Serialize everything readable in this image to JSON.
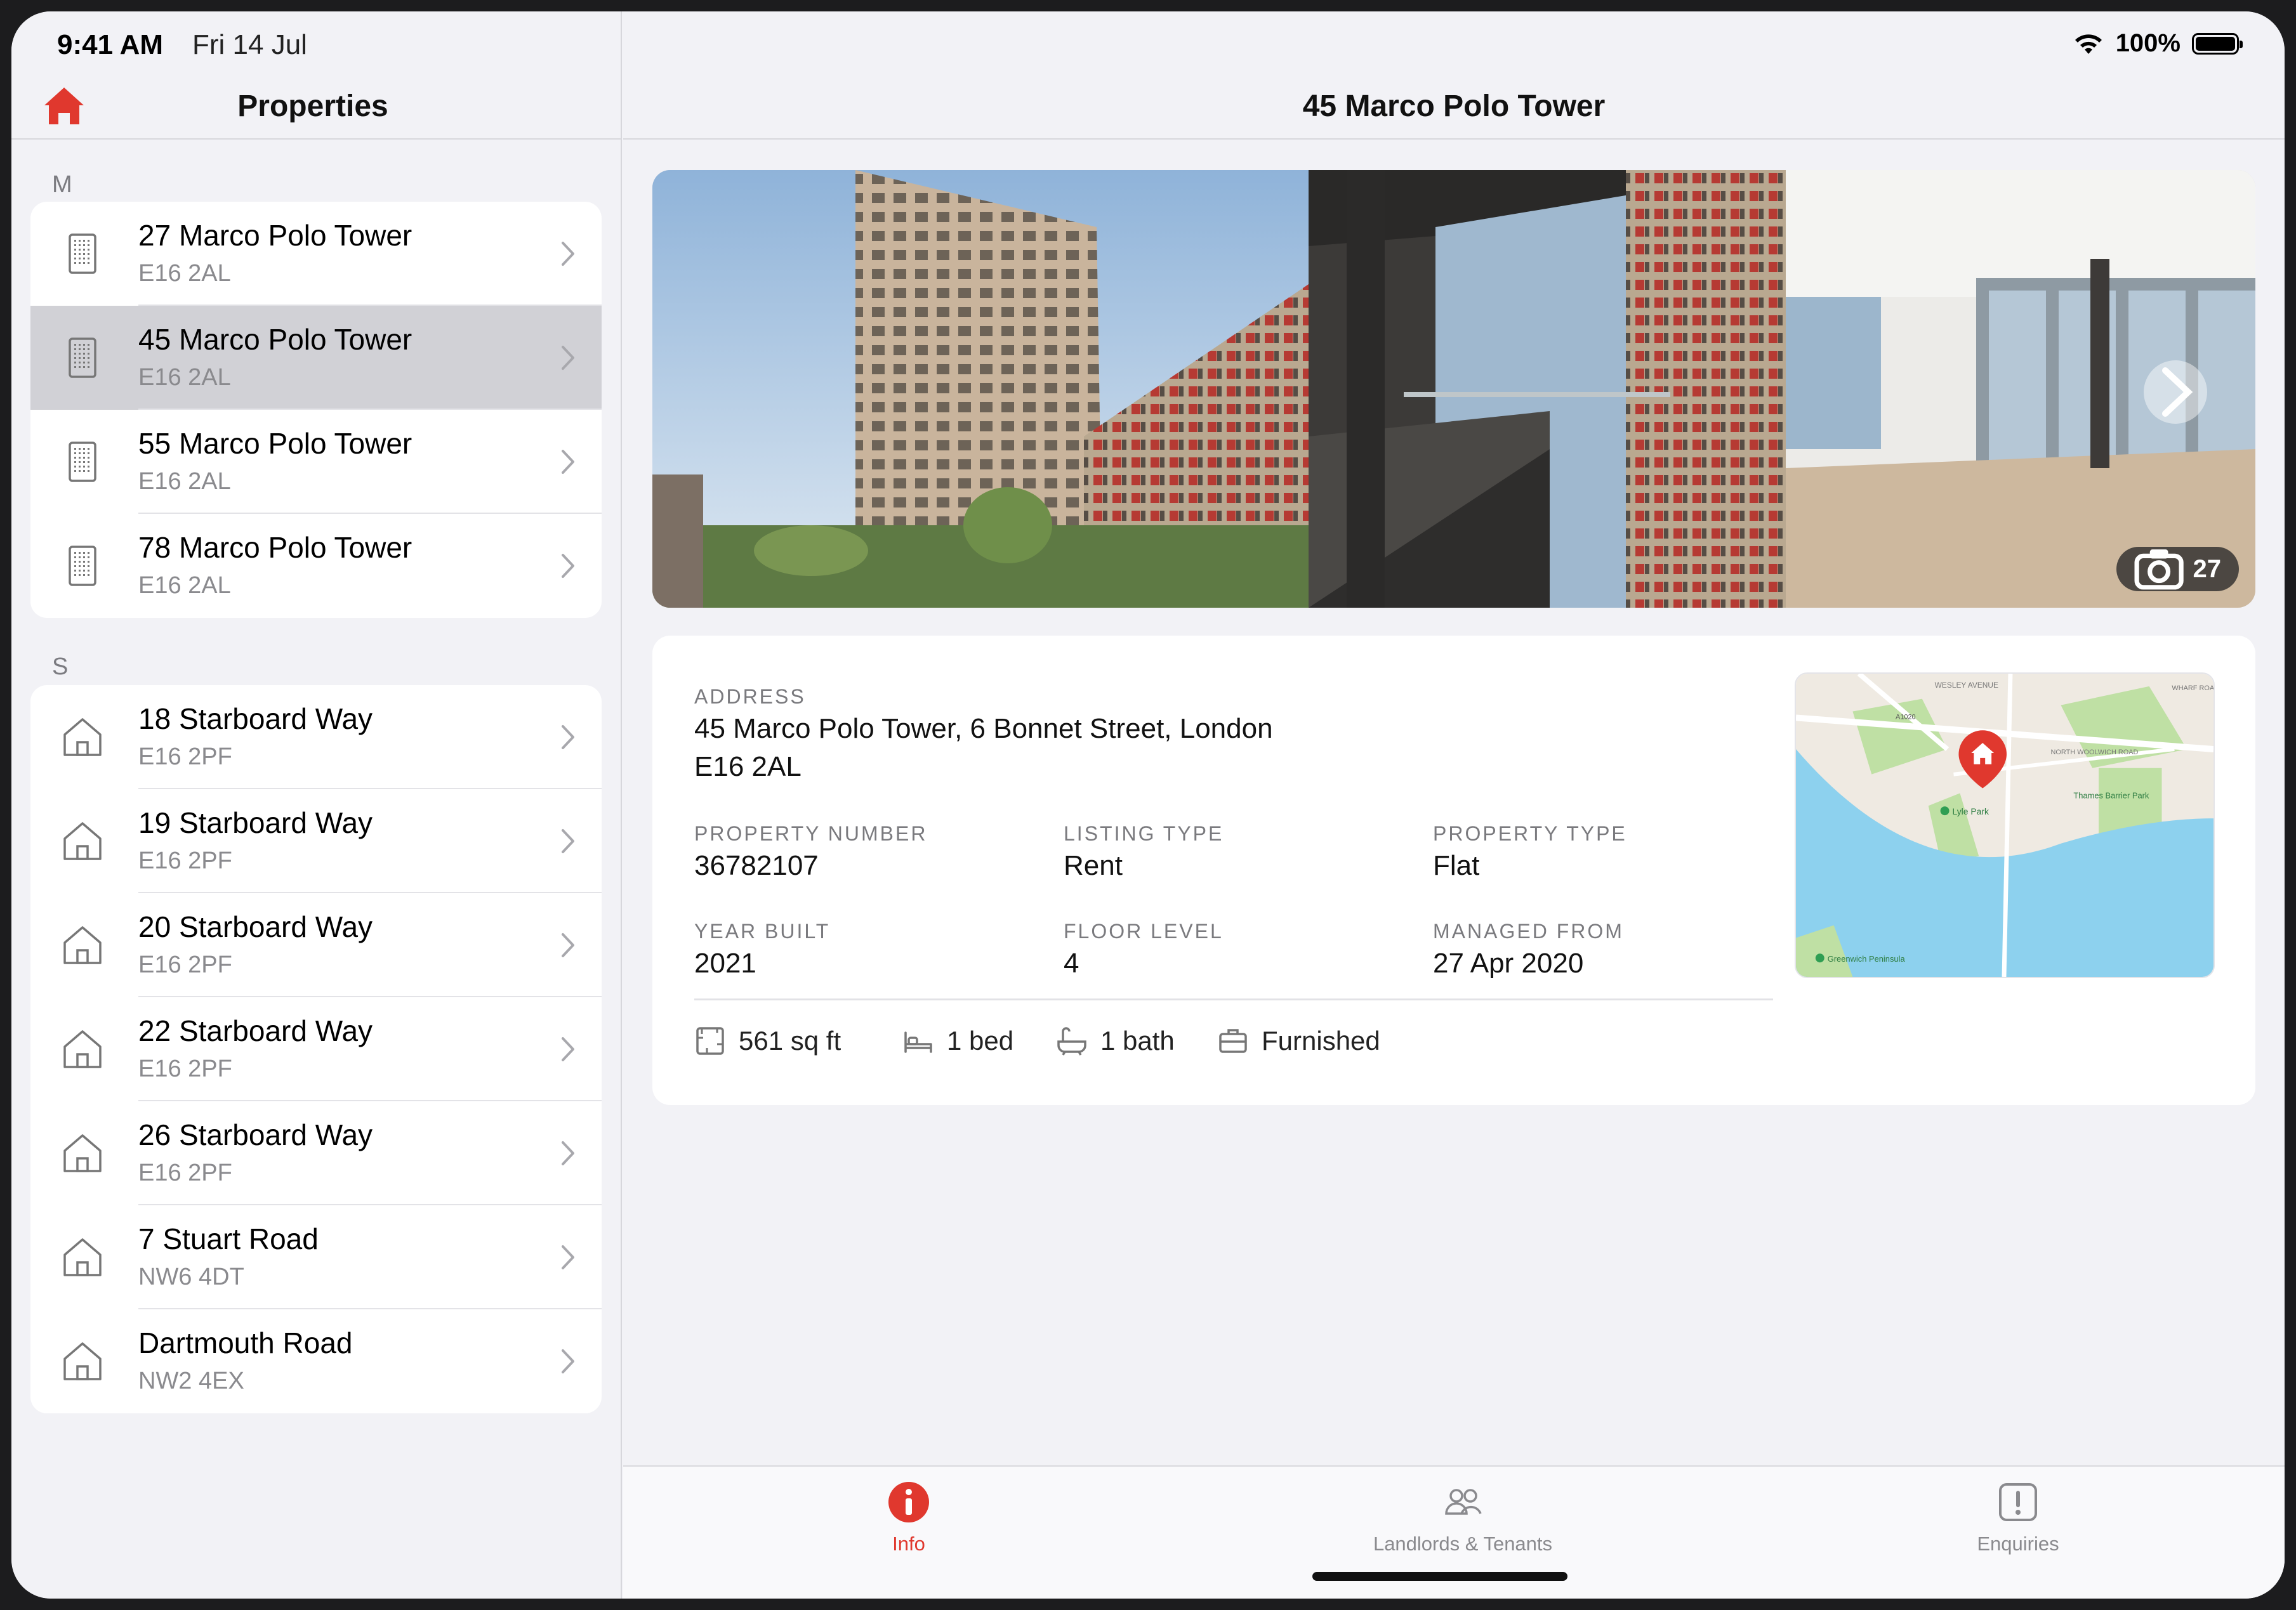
{
  "status_bar": {
    "time": "9:41 AM",
    "date": "Fri 14 Jul",
    "battery": "100%"
  },
  "sidebar": {
    "title": "Properties",
    "sections": [
      {
        "header": "M",
        "items": [
          {
            "title": "27 Marco Polo Tower",
            "postcode": "E16 2AL",
            "icon": "building-icon",
            "selected": false
          },
          {
            "title": "45 Marco Polo Tower",
            "postcode": "E16 2AL",
            "icon": "building-icon",
            "selected": true
          },
          {
            "title": "55 Marco Polo Tower",
            "postcode": "E16 2AL",
            "icon": "building-icon",
            "selected": false
          },
          {
            "title": "78 Marco Polo Tower",
            "postcode": "E16 2AL",
            "icon": "building-icon",
            "selected": false
          }
        ]
      },
      {
        "header": "S",
        "items": [
          {
            "title": "18 Starboard Way",
            "postcode": "E16 2PF",
            "icon": "house-icon",
            "selected": false
          },
          {
            "title": "19 Starboard Way",
            "postcode": "E16 2PF",
            "icon": "house-icon",
            "selected": false
          },
          {
            "title": "20 Starboard Way",
            "postcode": "E16 2PF",
            "icon": "house-icon",
            "selected": false
          },
          {
            "title": "22 Starboard Way",
            "postcode": "E16 2PF",
            "icon": "house-icon",
            "selected": false
          },
          {
            "title": "26 Starboard Way",
            "postcode": "E16 2PF",
            "icon": "house-icon",
            "selected": false
          },
          {
            "title": "7 Stuart Road",
            "postcode": "NW6 4DT",
            "icon": "house-icon",
            "selected": false
          },
          {
            "title": "Dartmouth Road",
            "postcode": "NW2 4EX",
            "icon": "house-icon",
            "selected": false
          }
        ]
      }
    ]
  },
  "detail": {
    "title": "45 Marco Polo Tower",
    "gallery": {
      "photo_count": "27"
    },
    "address": {
      "label": "ADDRESS",
      "line1": "45 Marco Polo Tower, 6 Bonnet Street, London",
      "line2": "E16 2AL"
    },
    "fields": [
      {
        "label": "PROPERTY NUMBER",
        "value": "36782107"
      },
      {
        "label": "LISTING TYPE",
        "value": "Rent"
      },
      {
        "label": "PROPERTY TYPE",
        "value": "Flat"
      },
      {
        "label": "YEAR BUILT",
        "value": "2021"
      },
      {
        "label": "FLOOR LEVEL",
        "value": "4"
      },
      {
        "label": "MANAGED FROM",
        "value": "27 Apr 2020"
      }
    ],
    "features": [
      {
        "icon": "floorplan-icon",
        "label": "561 sq ft"
      },
      {
        "icon": "bed-icon",
        "label": "1 bed"
      },
      {
        "icon": "bath-icon",
        "label": "1 bath"
      },
      {
        "icon": "furnished-icon",
        "label": "Furnished"
      }
    ],
    "map_labels": {
      "road_a": "WESLEY AVENUE",
      "road_b": "NORTH WOOLWICH ROAD",
      "road_c": "WHARF ROAD",
      "park_a": "Lyle Park",
      "park_b": "Thames Barrier Park",
      "area": "Greenwich Peninsula",
      "route": "A1020"
    }
  },
  "tabs": [
    {
      "label": "Info",
      "icon": "info-icon",
      "active": true
    },
    {
      "label": "Landlords & Tenants",
      "icon": "people-icon",
      "active": false
    },
    {
      "label": "Enquiries",
      "icon": "exclamation-icon",
      "active": false
    }
  ],
  "colors": {
    "accent": "#e0382e",
    "background": "#f2f2f6",
    "selected_row": "#d1d1d6"
  }
}
